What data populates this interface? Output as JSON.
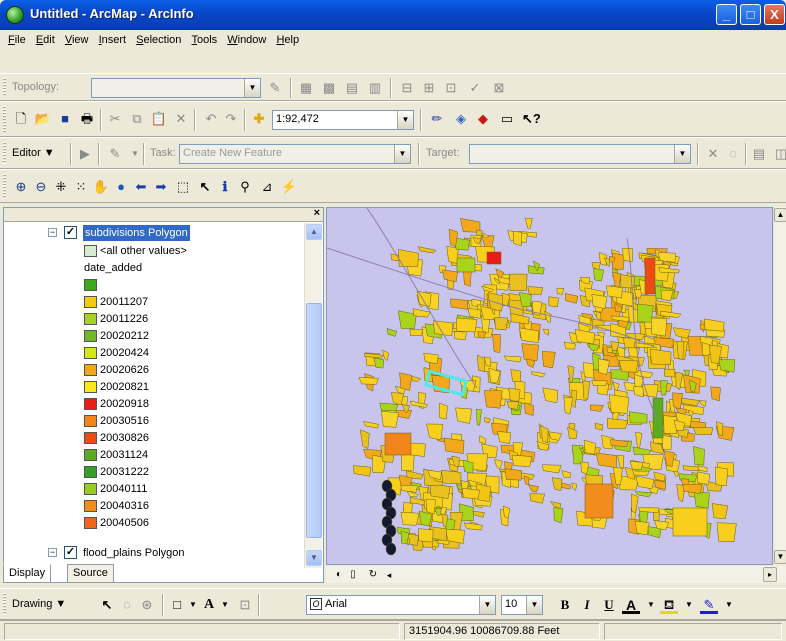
{
  "window": {
    "title": "Untitled - ArcMap - ArcInfo",
    "minimize": "_",
    "maximize": "□",
    "close": "X"
  },
  "menu": [
    "File",
    "Edit",
    "View",
    "Insert",
    "Selection",
    "Tools",
    "Window",
    "Help"
  ],
  "topology": {
    "label": "Topology:",
    "value": ""
  },
  "standard": {
    "scale": "1:92,472"
  },
  "editor": {
    "label": "Editor ▼",
    "task_label": "Task:",
    "task_value": "Create New Feature",
    "target_label": "Target:",
    "target_value": ""
  },
  "toc": {
    "layer1": "subdivisions Polygon",
    "items": [
      {
        "label": "<all other values>",
        "color": "#d6ecd2"
      },
      {
        "label": "date_added",
        "color": ""
      },
      {
        "label": "",
        "color": "#3ea81c"
      },
      {
        "label": "20011207",
        "color": "#f2cc10"
      },
      {
        "label": "20011226",
        "color": "#a8d41c"
      },
      {
        "label": "20020212",
        "color": "#72b828"
      },
      {
        "label": "20020424",
        "color": "#d2e81c"
      },
      {
        "label": "20020626",
        "color": "#f2a81a"
      },
      {
        "label": "20020821",
        "color": "#f8e81a"
      },
      {
        "label": "20020918",
        "color": "#ea1c18"
      },
      {
        "label": "20030516",
        "color": "#f2841c"
      },
      {
        "label": "20030826",
        "color": "#ee4a16"
      },
      {
        "label": "20031124",
        "color": "#5aaa22"
      },
      {
        "label": "20031222",
        "color": "#32a02a"
      },
      {
        "label": "20040111",
        "color": "#98cc22"
      },
      {
        "label": "20040316",
        "color": "#f28c1c"
      },
      {
        "label": "20040506",
        "color": "#f26418"
      }
    ],
    "layer2": "flood_plains Polygon",
    "tabs": {
      "display": "Display",
      "source": "Source"
    }
  },
  "drawing": {
    "label": "Drawing ▼",
    "font": "Arial",
    "size": "10",
    "bold": "B",
    "italic": "I",
    "underline": "U",
    "fontcolor": "A"
  },
  "status": {
    "coords": "3151904.96  10086709.88 Feet"
  }
}
